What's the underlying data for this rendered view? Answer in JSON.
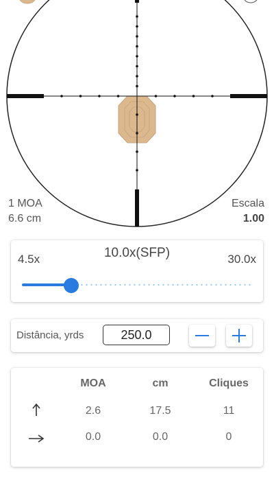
{
  "scope": {
    "moa_label": "1 MOA",
    "moa_value": "6.6 cm",
    "scale_label": "Escala",
    "scale_value": "1.00"
  },
  "zoom": {
    "min_label": "4.5x",
    "current_label": "10.0x(SFP)",
    "max_label": "30.0x",
    "slider_fraction": 0.215
  },
  "distance": {
    "label": "Distância, yrds",
    "value": "250.0"
  },
  "table": {
    "headers": [
      "MOA",
      "cm",
      "Cliques"
    ],
    "rows": [
      {
        "icon": "arrow-up-icon",
        "values": [
          "2.6",
          "17.5",
          "11"
        ]
      },
      {
        "icon": "arrow-right-icon",
        "values": [
          "0.0",
          "0.0",
          "0"
        ]
      }
    ]
  },
  "colors": {
    "accent": "#2a7be0",
    "track": "#8ec6f3",
    "target": "#dcb88e",
    "reticle": "#111111"
  }
}
